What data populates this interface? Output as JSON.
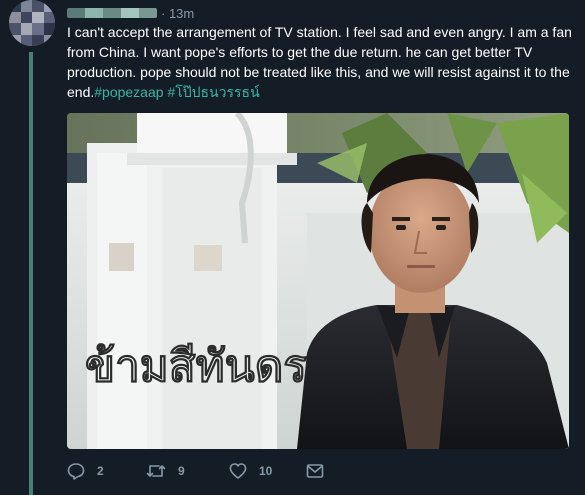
{
  "tweet": {
    "time": "· 13m",
    "text_main": "I can't accept the arrangement of TV station. I feel sad and even angry. I am a fan from China. I want pope's efforts to get the due return. he can get better TV production. pope should not be treated like this, and we will resist against it to the end.",
    "hashtags": [
      "#popezaap",
      "#โป๊ปธนวรรธน์"
    ],
    "media": {
      "overlay_text_line1": "ข้ามสีทันดร",
      "overlay_text_line2": ""
    },
    "actions": {
      "reply_count": "2",
      "retweet_count": "9",
      "like_count": "10"
    }
  },
  "icons": {
    "reply": "reply-icon",
    "retweet": "retweet-icon",
    "like": "heart-icon",
    "message": "envelope-icon"
  },
  "colors": {
    "background": "#141d26",
    "hashtag": "#38b4a8",
    "muted": "#8899a6",
    "thread_line": "#4b7d73"
  }
}
